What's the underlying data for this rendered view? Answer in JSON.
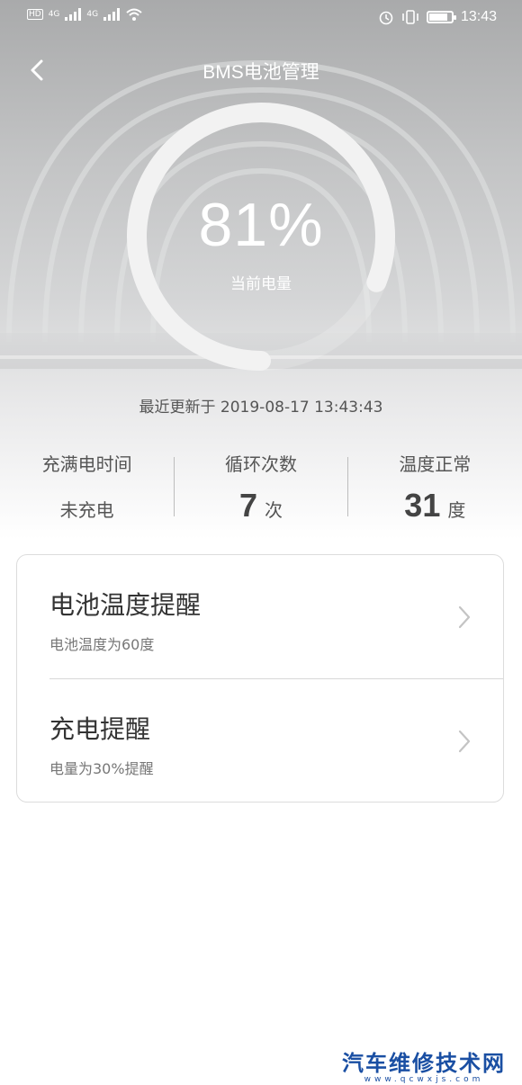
{
  "status_bar": {
    "left_badges": [
      "HD",
      "4G",
      "4G"
    ],
    "time": "13:43",
    "icons": [
      "alarm-icon",
      "vibrate-icon",
      "battery-icon"
    ]
  },
  "header": {
    "title": "BMS电池管理",
    "back_icon": "chevron-left-icon"
  },
  "battery": {
    "percent_text": "81%",
    "level_fraction": 0.81,
    "label": "当前电量"
  },
  "updated": "最近更新于 2019-08-17 13:43:43",
  "stats": [
    {
      "label": "充满电时间",
      "value": "未充电",
      "unit": ""
    },
    {
      "label": "循环次数",
      "value": "7",
      "unit": "次"
    },
    {
      "label": "温度正常",
      "value": "31",
      "unit": "度"
    }
  ],
  "reminders": [
    {
      "title": "电池温度提醒",
      "subtitle": "电池温度为60度"
    },
    {
      "title": "充电提醒",
      "subtitle": "电量为30%提醒"
    }
  ],
  "watermark": {
    "main": "汽车维修技术网",
    "sub": "www.qcwxjs.com"
  },
  "colors": {
    "ring": "#f2f2f2",
    "watermark": "#1a4fa3"
  }
}
